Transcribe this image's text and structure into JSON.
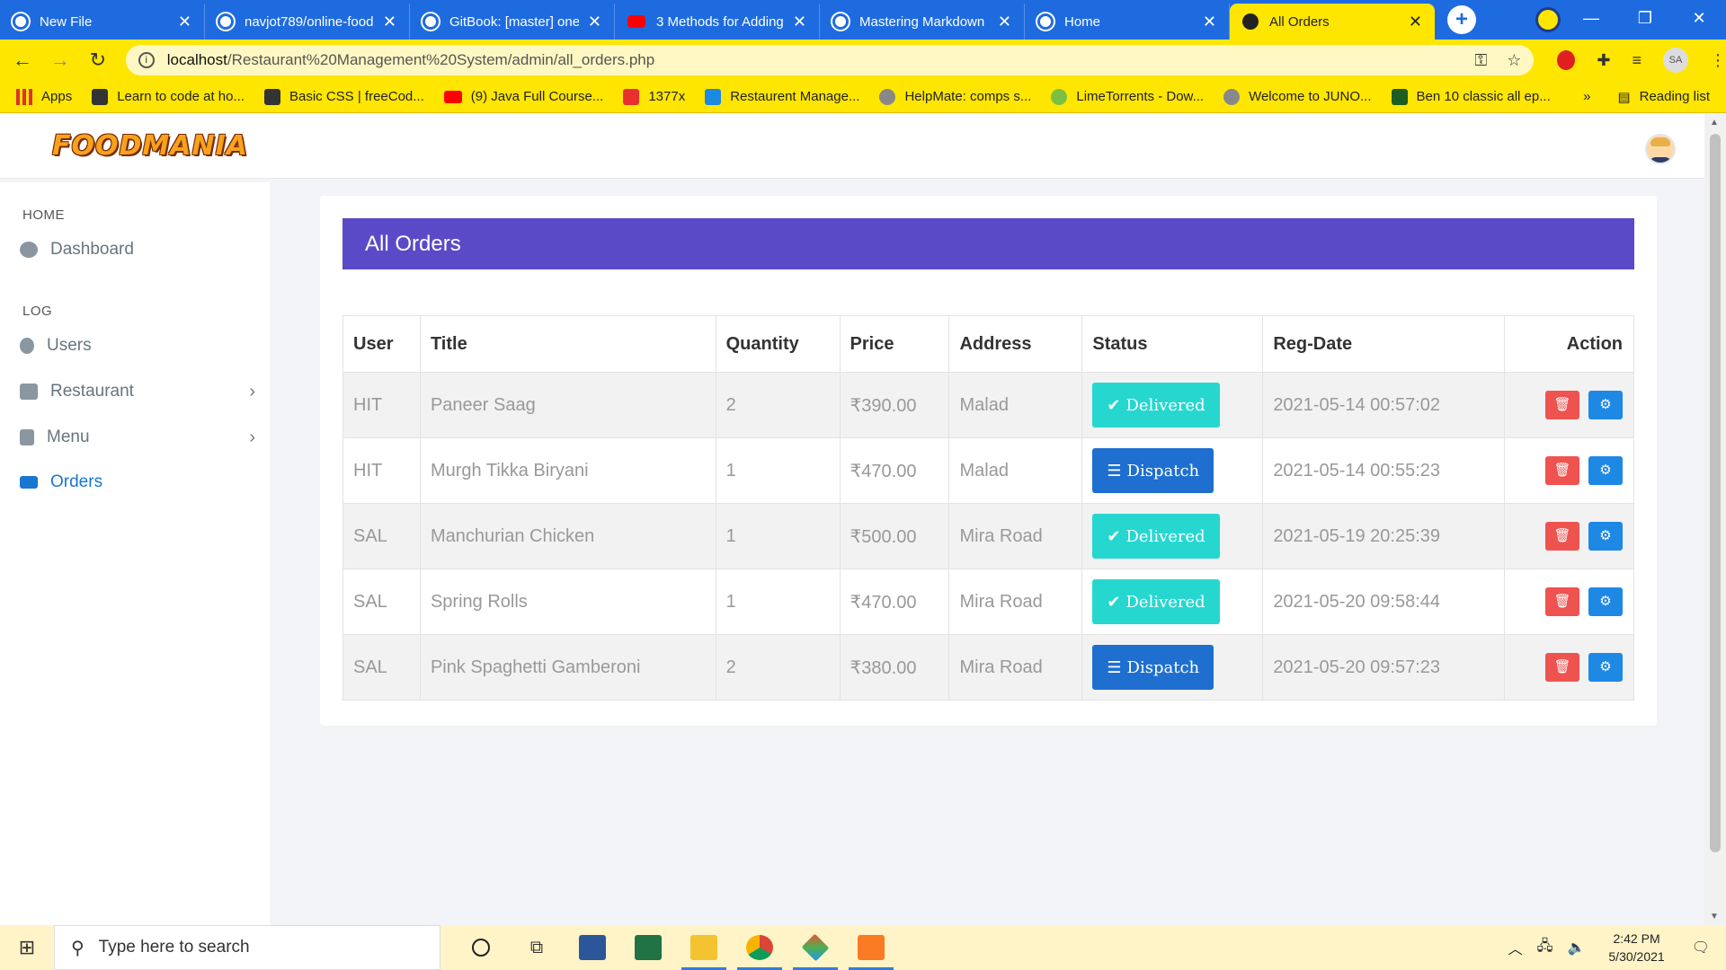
{
  "browser": {
    "tabs": [
      {
        "title": "New File",
        "active": false
      },
      {
        "title": "navjot789/online-food",
        "active": false
      },
      {
        "title": "GitBook: [master] one",
        "active": false
      },
      {
        "title": "3 Methods for Adding",
        "active": false
      },
      {
        "title": "Mastering Markdown",
        "active": false
      },
      {
        "title": "Home",
        "active": false
      },
      {
        "title": "All Orders",
        "active": true
      }
    ],
    "url_host": "localhost",
    "url_path": "/Restaurant%20Management%20System/admin/all_orders.php",
    "profile_initials": "SA",
    "bookmarks": [
      {
        "label": "Apps"
      },
      {
        "label": "Learn to code at ho..."
      },
      {
        "label": "Basic CSS | freeCod..."
      },
      {
        "label": "(9) Java Full Course..."
      },
      {
        "label": "1377x"
      },
      {
        "label": "Restaurent Manage..."
      },
      {
        "label": "HelpMate: comps s..."
      },
      {
        "label": "LimeTorrents - Dow..."
      },
      {
        "label": "Welcome to JUNO..."
      },
      {
        "label": "Ben 10 classic all ep..."
      }
    ],
    "more_bookmarks": "»",
    "reading_list": "Reading list"
  },
  "app": {
    "logo_text": "FOODMANIA",
    "sidebar": {
      "section_home": "HOME",
      "section_log": "LOG",
      "items": [
        {
          "label": "Dashboard"
        },
        {
          "label": "Users"
        },
        {
          "label": "Restaurant"
        },
        {
          "label": "Menu"
        },
        {
          "label": "Orders"
        }
      ]
    },
    "card_title": "All Orders",
    "table": {
      "headers": [
        "User",
        "Title",
        "Quantity",
        "Price",
        "Address",
        "Status",
        "Reg-Date",
        "Action"
      ],
      "rows": [
        {
          "user": "HIT",
          "title": "Paneer Saag",
          "quantity": "2",
          "price": "₹390.00",
          "address": "Malad",
          "status": "Delivered",
          "date": "2021-05-14 00:57:02"
        },
        {
          "user": "HIT",
          "title": "Murgh Tikka Biryani",
          "quantity": "1",
          "price": "₹470.00",
          "address": "Malad",
          "status": "Dispatch",
          "date": "2021-05-14 00:55:23"
        },
        {
          "user": "SAL",
          "title": "Manchurian Chicken",
          "quantity": "1",
          "price": "₹500.00",
          "address": "Mira Road",
          "status": "Delivered",
          "date": "2021-05-19 20:25:39"
        },
        {
          "user": "SAL",
          "title": "Spring Rolls",
          "quantity": "1",
          "price": "₹470.00",
          "address": "Mira Road",
          "status": "Delivered",
          "date": "2021-05-20 09:58:44"
        },
        {
          "user": "SAL",
          "title": "Pink Spaghetti Gamberoni",
          "quantity": "2",
          "price": "₹380.00",
          "address": "Mira Road",
          "status": "Dispatch",
          "date": "2021-05-20 09:57:23"
        }
      ]
    }
  },
  "taskbar": {
    "search_placeholder": "Type here to search",
    "time": "2:42 PM",
    "date": "5/30/2021"
  },
  "colors": {
    "header_purple": "#5b4ac7",
    "delivered_teal": "#26d7d0",
    "dispatch_blue": "#1e6fd0",
    "delete_red": "#ef5350",
    "settings_blue": "#1e88e5",
    "chrome_yellow": "#ffe600",
    "tabbar_blue": "#1e6be0"
  }
}
